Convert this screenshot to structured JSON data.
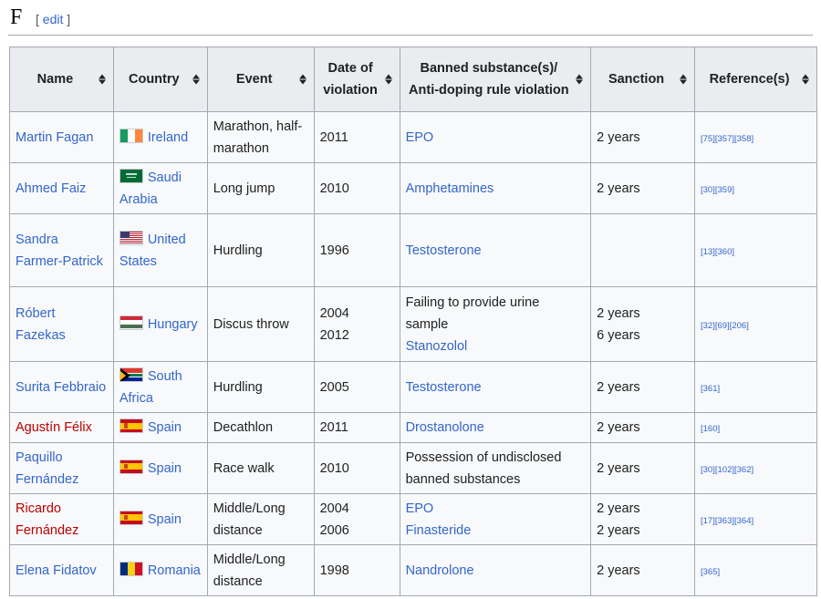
{
  "section": {
    "title": "F",
    "edit_open": "[",
    "edit_label": "edit",
    "edit_close": "]"
  },
  "columns": [
    "Name",
    "Country",
    "Event",
    "Date of violation",
    "Banned substance(s)/ Anti-doping rule violation",
    "Sanction",
    "Reference(s)"
  ],
  "colors": {
    "link": "#3366cc",
    "redlink": "#ba0000",
    "header_bg": "#eaecf0",
    "cell_bg": "#f8f9fa",
    "border": "#a2a9b1"
  },
  "rows": [
    {
      "name": "Martin Fagan",
      "name_red": false,
      "flag": "ireland-flag-icon",
      "country": "Ireland",
      "event": "Marathon, half-marathon",
      "date": "2011",
      "substance": [
        {
          "text": "EPO",
          "link": true
        }
      ],
      "sanction": "2 years",
      "refs": [
        "[75]",
        "[357]",
        "[358]"
      ]
    },
    {
      "name": "Ahmed Faiz",
      "name_red": false,
      "flag": "saudi-arabia-flag-icon",
      "country": "Saudi Arabia",
      "event": "Long jump",
      "date": "2010",
      "substance": [
        {
          "text": "Amphetamines",
          "link": true
        }
      ],
      "sanction": "2 years",
      "refs": [
        "[30]",
        "[359]"
      ]
    },
    {
      "name": "Sandra Farmer-Patrick",
      "name_red": false,
      "flag": "united-states-flag-icon",
      "country": "United States",
      "event": "Hurdling",
      "date": "1996",
      "substance": [
        {
          "text": "Testosterone",
          "link": true
        }
      ],
      "sanction": "",
      "refs": [
        "[13]",
        "[360]"
      ]
    },
    {
      "name": "Róbert Fazekas",
      "name_red": false,
      "flag": "hungary-flag-icon",
      "country": "Hungary",
      "event": "Discus throw",
      "date": "2004\n2012",
      "substance": [
        {
          "text": "Failing to provide urine sample",
          "link": false
        },
        {
          "text": "Stanozolol",
          "link": true
        }
      ],
      "sanction": "2 years\n6 years",
      "refs": [
        "[32]",
        "[69]",
        "[206]"
      ]
    },
    {
      "name": "Surita Febbraio",
      "name_red": false,
      "flag": "south-africa-flag-icon",
      "country": "South Africa",
      "event": "Hurdling",
      "date": "2005",
      "substance": [
        {
          "text": "Testosterone",
          "link": true
        }
      ],
      "sanction": "2 years",
      "refs": [
        "[361]"
      ]
    },
    {
      "name": "Agustín Félix",
      "name_red": true,
      "flag": "spain-flag-icon",
      "country": "Spain",
      "event": "Decathlon",
      "date": "2011",
      "substance": [
        {
          "text": "Drostanolone",
          "link": true
        }
      ],
      "sanction": "2 years",
      "refs": [
        "[160]"
      ]
    },
    {
      "name": "Paquillo Fernández",
      "name_red": false,
      "flag": "spain-flag-icon",
      "country": "Spain",
      "event": "Race walk",
      "date": "2010",
      "substance": [
        {
          "text": "Possession of undisclosed banned substances",
          "link": false
        }
      ],
      "sanction": "2 years",
      "refs": [
        "[30]",
        "[102]",
        "[362]"
      ]
    },
    {
      "name": "Ricardo Fernández",
      "name_red": true,
      "flag": "spain-flag-icon",
      "country": "Spain",
      "event": "Middle/Long distance",
      "date": "2004\n2006",
      "substance": [
        {
          "text": "EPO",
          "link": true
        },
        {
          "text": "Finasteride",
          "link": true
        }
      ],
      "sanction": "2 years\n2 years",
      "refs": [
        "[17]",
        "[363]",
        "[364]"
      ]
    },
    {
      "name": "Elena Fidatov",
      "name_red": false,
      "flag": "romania-flag-icon",
      "country": "Romania",
      "event": "Middle/Long distance",
      "date": "1998",
      "substance": [
        {
          "text": "Nandrolone",
          "link": true
        }
      ],
      "sanction": "2 years",
      "refs": [
        "[365]"
      ]
    }
  ]
}
